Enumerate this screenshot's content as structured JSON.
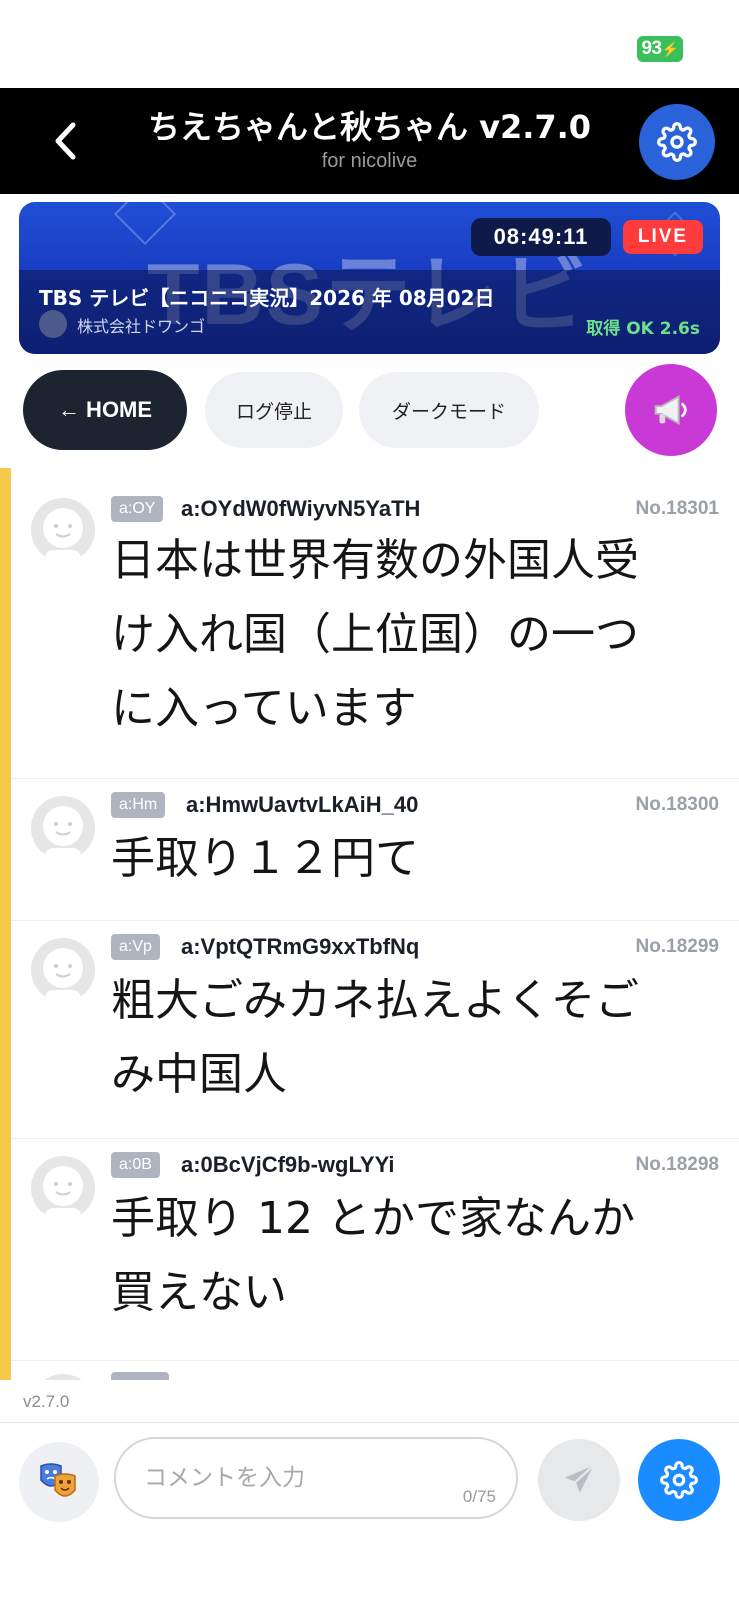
{
  "status_bar": {
    "battery": "93"
  },
  "header": {
    "title": "ちえちゃんと秋ちゃん v2.7.0",
    "subtitle": "for nicolive"
  },
  "program": {
    "watermark": "TBSテレビ",
    "elapsed_time": "08:49:11",
    "live_label": "LIVE",
    "title": "TBS テレビ【ニコニコ実況】2026 年 08月02日",
    "channel": "株式会社ドワンゴ",
    "fetch_status": "取得 OK 2.6s"
  },
  "toolbar": {
    "home_label": "← HOME",
    "log_stop_label": "ログ停止",
    "dark_mode_label": "ダークモード",
    "announce_icon": "megaphone-icon"
  },
  "comments": [
    {
      "badge": "a:OY",
      "user_id": "a:OYdW0fWiyvN5YaTH",
      "number": "No.18301",
      "lines": [
        "日本は世界有数の外国人受",
        "け入れ国（上位国）の一つ",
        "に入っています"
      ]
    },
    {
      "badge": "a:Hm",
      "user_id": "a:HmwUavtvLkAiH_40",
      "number": "No.18300",
      "lines": [
        "手取り１２円て"
      ]
    },
    {
      "badge": "a:Vp",
      "user_id": "a:VptQTRmG9xxTbfNq",
      "number": "No.18299",
      "lines": [
        "粗大ごみカネ払えよくそご",
        "み中国人"
      ]
    },
    {
      "badge": "a:0B",
      "user_id": "a:0BcVjCf9b-wgLYYi",
      "number": "No.18298",
      "lines": [
        "手取り 12 とかで家なんか",
        "買えない"
      ]
    }
  ],
  "footer": {
    "version": "v2.7.0",
    "input_placeholder": "コメントを入力",
    "char_count": "0/75"
  },
  "colors": {
    "accent_blue": "#1a8cff",
    "header_settings": "#2962d9",
    "announce": "#c839d6",
    "live_red": "#ff3b3b",
    "stream_bar": "#f5c94a"
  }
}
